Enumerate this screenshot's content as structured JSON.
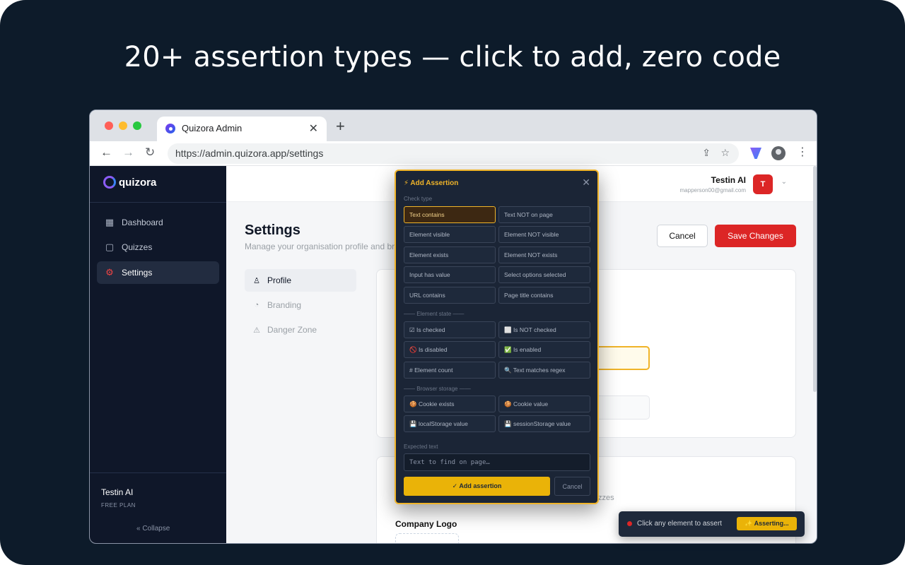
{
  "headline": "20+ assertion types — click to add, zero code",
  "browser": {
    "tab_title": "Quizora Admin",
    "tab_close": "✕",
    "new_tab": "+",
    "url": "https://admin.quizora.app/settings",
    "icons": [
      "back-arrow-icon",
      "forward-arrow-icon",
      "reload-icon",
      "share-icon",
      "star-icon",
      "extension-icon",
      "profile-icon",
      "kebab-menu-icon"
    ]
  },
  "sidebar": {
    "brand": "quizora",
    "items": [
      {
        "label": "Dashboard",
        "icon": "grid-icon",
        "glyph": "▦"
      },
      {
        "label": "Quizzes",
        "icon": "book-icon",
        "glyph": "▢"
      },
      {
        "label": "Settings",
        "icon": "gear-icon",
        "glyph": "⚙"
      }
    ],
    "user": "Testin AI",
    "plan": "FREE PLAN",
    "collapse": "«  Collapse"
  },
  "topbar": {
    "user_name": "Testin AI",
    "user_email": "mapperson00@gmail.com",
    "avatar": "T"
  },
  "settings": {
    "title": "Settings",
    "subtitle": "Manage your organisation profile and bra",
    "cancel_label": "Cancel",
    "save_label": "Save Changes",
    "subnav": [
      {
        "label": "Profile",
        "icon": "user-icon",
        "glyph": "♙"
      },
      {
        "label": "Branding",
        "icon": "palette-icon",
        "glyph": "◔"
      },
      {
        "label": "Danger Zone",
        "icon": "warning-icon",
        "glyph": "⚠"
      }
    ],
    "card2_tail": "zzes",
    "company_logo_label": "Company Logo"
  },
  "modal": {
    "title": "⚡ Add Assertion",
    "close": "✕",
    "check_type_label": "Check type",
    "check_types": [
      "Text contains",
      "Text NOT on page",
      "Element visible",
      "Element NOT visible",
      "Element exists",
      "Element NOT exists",
      "Input has value",
      "Select options selected",
      "URL contains",
      "Page title contains"
    ],
    "selected": "Text contains",
    "element_state_label": "—— Element state ——",
    "element_state": [
      "☑ Is checked",
      "⬜ Is NOT checked",
      "🚫 Is disabled",
      "✅ Is enabled",
      "# Element count",
      "🔍 Text matches regex"
    ],
    "browser_storage_label": "—— Browser storage ——",
    "browser_storage": [
      "🍪 Cookie exists",
      "🍪 Cookie value",
      "💾 localStorage value",
      "💾 sessionStorage value"
    ],
    "expected_text_label": "Expected text",
    "expected_text_placeholder": "Text to find on page…",
    "add_label": "✓ Add assertion",
    "cancel_label": "Cancel"
  },
  "toast": {
    "text": "Click any element to assert",
    "badge": "✨ Asserting..."
  },
  "colors": {
    "background": "#0d1b2a",
    "accent": "#f0b429",
    "danger": "#dc2626",
    "sidebar": "#0f1729"
  }
}
